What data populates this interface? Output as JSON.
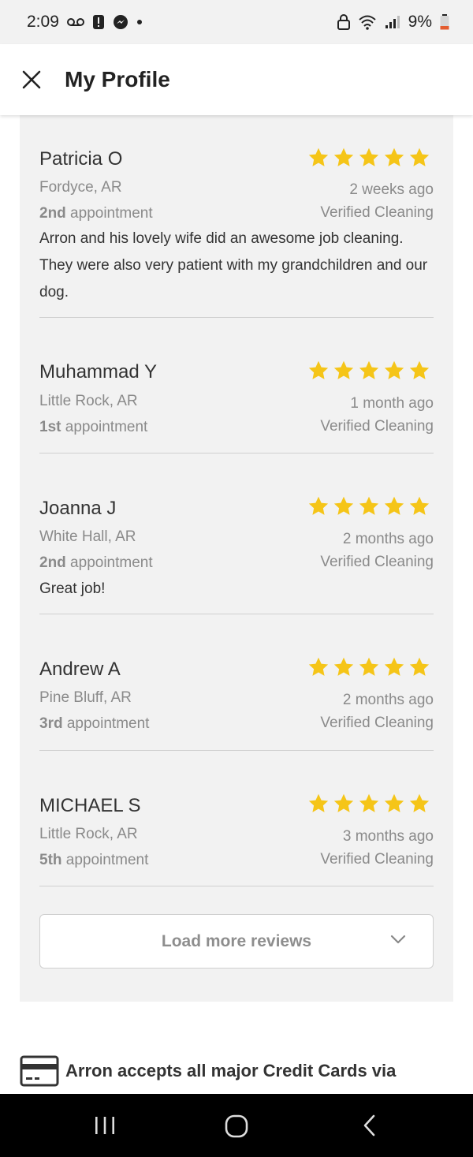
{
  "status_bar": {
    "time": "2:09",
    "battery": "9%",
    "left_icons": [
      "voicemail-icon",
      "alert-icon",
      "messenger-icon",
      "dot-icon"
    ],
    "right_icons": [
      "lock-icon",
      "wifi-icon",
      "signal-icon",
      "battery-icon"
    ]
  },
  "header": {
    "title": "My Profile"
  },
  "colors": {
    "star": "#f5c518",
    "panel": "#f2f2f2",
    "muted": "#8a8a8a"
  },
  "reviews": [
    {
      "name": "Patricia O",
      "location": "Fordyce, AR",
      "appointment_ordinal": "2nd",
      "appointment_label": " appointment",
      "time_ago": "2 weeks ago",
      "verified": "Verified Cleaning",
      "rating": 5,
      "text": "Arron and his lovely wife did an awesome job cleaning. They were also very patient with my grandchildren and our dog."
    },
    {
      "name": "Muhammad Y",
      "location": "Little Rock, AR",
      "appointment_ordinal": "1st",
      "appointment_label": " appointment",
      "time_ago": "1 month ago",
      "verified": "Verified Cleaning",
      "rating": 5,
      "text": ""
    },
    {
      "name": "Joanna J",
      "location": "White Hall, AR",
      "appointment_ordinal": "2nd",
      "appointment_label": " appointment",
      "time_ago": "2 months ago",
      "verified": "Verified Cleaning",
      "rating": 5,
      "text": "Great job!"
    },
    {
      "name": "Andrew A",
      "location": "Pine Bluff, AR",
      "appointment_ordinal": "3rd",
      "appointment_label": " appointment",
      "time_ago": "2 months ago",
      "verified": "Verified Cleaning",
      "rating": 5,
      "text": ""
    },
    {
      "name": "MICHAEL S",
      "location": "Little Rock, AR",
      "appointment_ordinal": "5th",
      "appointment_label": " appointment",
      "time_ago": "3 months ago",
      "verified": "Verified Cleaning",
      "rating": 5,
      "text": ""
    }
  ],
  "load_more": {
    "label": "Load more reviews"
  },
  "payment": {
    "text": "Arron accepts all major Credit Cards via"
  },
  "nav_bar": {
    "buttons": [
      "recent-apps",
      "home",
      "back"
    ]
  }
}
